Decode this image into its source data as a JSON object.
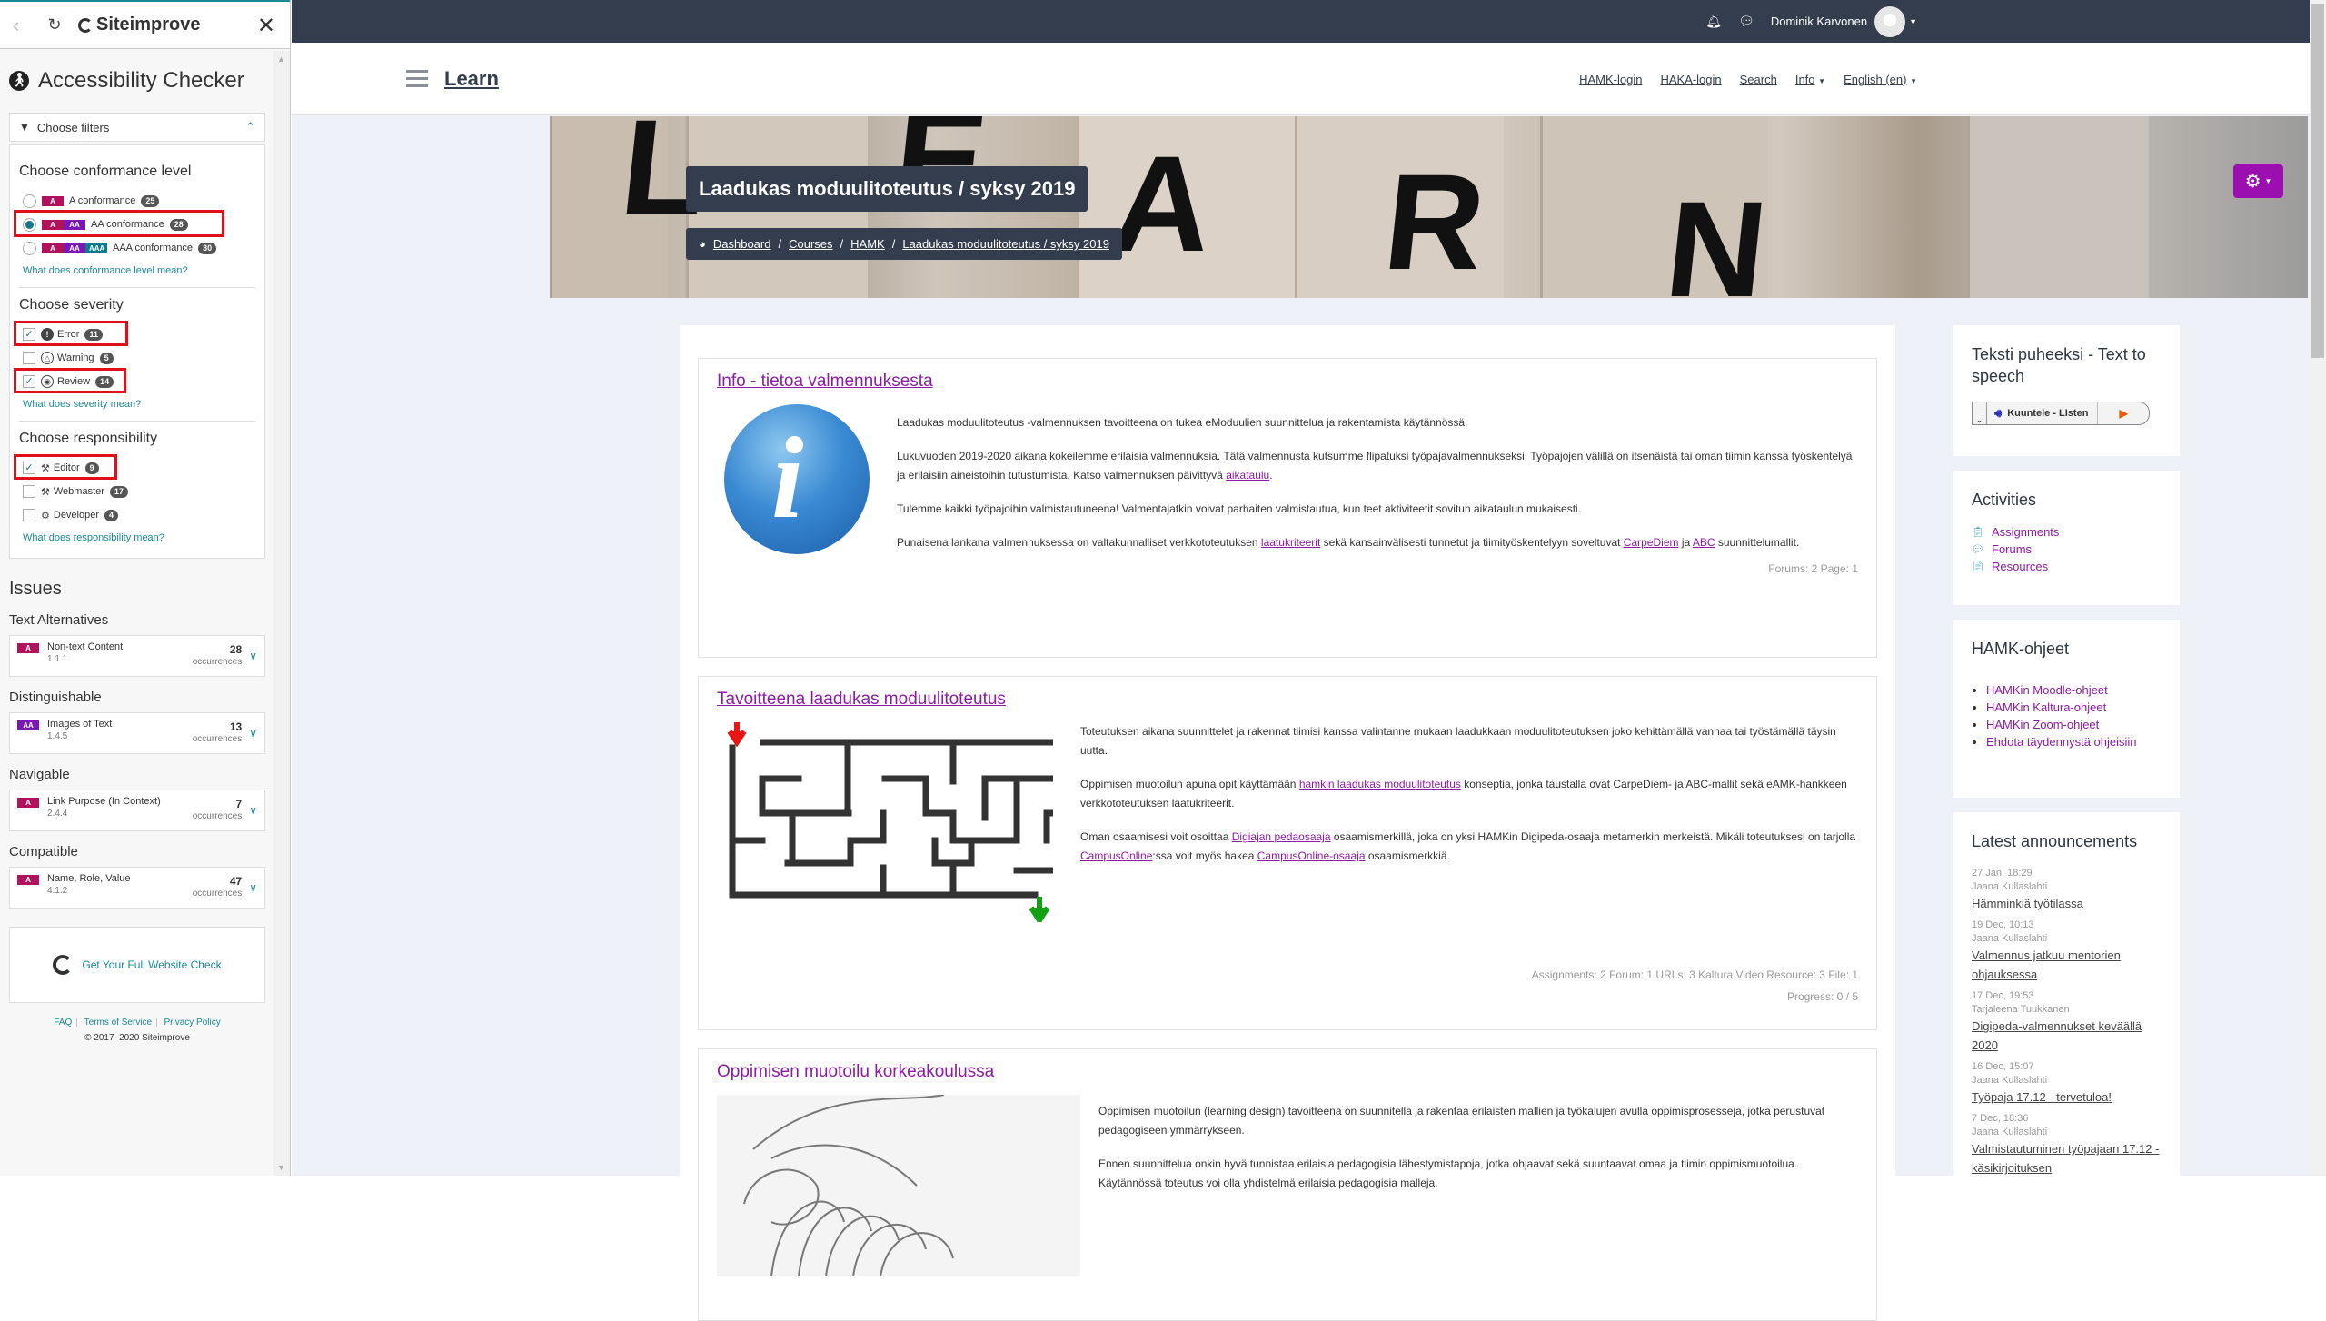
{
  "siteimprove": {
    "brand": "Siteimprove",
    "title": "Accessibility Checker",
    "filters_label": "Choose filters",
    "conformance": {
      "heading": "Choose conformance level",
      "options": [
        {
          "label": "A conformance",
          "count": "25",
          "levels": [
            "A"
          ],
          "selected": false
        },
        {
          "label": "AA conformance",
          "count": "28",
          "levels": [
            "A",
            "AA"
          ],
          "selected": true
        },
        {
          "label": "AAA conformance",
          "count": "30",
          "levels": [
            "A",
            "AA",
            "AAA"
          ],
          "selected": false
        }
      ],
      "help": "What does conformance level mean?"
    },
    "severity": {
      "heading": "Choose severity",
      "options": [
        {
          "label": "Error",
          "count": "11",
          "checked": true,
          "icon": "error-icon"
        },
        {
          "label": "Warning",
          "count": "5",
          "checked": false,
          "icon": "warning-icon"
        },
        {
          "label": "Review",
          "count": "14",
          "checked": true,
          "icon": "review-eye-icon"
        }
      ],
      "help": "What does severity mean?"
    },
    "responsibility": {
      "heading": "Choose responsibility",
      "options": [
        {
          "label": "Editor",
          "count": "9",
          "checked": true,
          "icon": "editor-icon"
        },
        {
          "label": "Webmaster",
          "count": "17",
          "checked": false,
          "icon": "webmaster-icon"
        },
        {
          "label": "Developer",
          "count": "4",
          "checked": false,
          "icon": "developer-icon"
        }
      ],
      "help": "What does responsibility mean?"
    },
    "issues_heading": "Issues",
    "issue_groups": [
      {
        "group": "Text Alternatives",
        "level": "A",
        "name": "Non-text Content",
        "code": "1.1.1",
        "count": "28",
        "unit": "occurrences"
      },
      {
        "group": "Distinguishable",
        "level": "AA",
        "name": "Images of Text",
        "code": "1.4.5",
        "count": "13",
        "unit": "occurrences"
      },
      {
        "group": "Navigable",
        "level": "A",
        "name": "Link Purpose (In Context)",
        "code": "2.4.4",
        "count": "7",
        "unit": "occurrences"
      },
      {
        "group": "Compatible",
        "level": "A",
        "name": "Name, Role, Value",
        "code": "4.1.2",
        "count": "47",
        "unit": "occurrences"
      }
    ],
    "full_check": "Get Your Full Website Check",
    "footer": {
      "faq": "FAQ",
      "terms": "Terms of Service",
      "privacy": "Privacy Policy",
      "copyright": "© 2017–2020 Siteimprove"
    }
  },
  "navbar": {
    "user": "Dominik Karvonen"
  },
  "subnav": {
    "brand": "Learn",
    "links": [
      "HAMK-login",
      "HAKA-login",
      "Search",
      "Info",
      "English (en)"
    ]
  },
  "hero": {
    "title": "Laadukas moduulitoteutus / syksy 2019",
    "breadcrumb": [
      "Dashboard",
      "Courses",
      "HAMK",
      "Laadukas moduulitoteutus / syksy 2019"
    ],
    "letters": [
      "L",
      "E",
      "A",
      "R",
      "N"
    ]
  },
  "sections": [
    {
      "title": "Info - tietoa valmennuksesta",
      "paragraphs": [
        [
          "Laadukas moduulitoteutus -valmennuksen tavoitteena on tukea eModuulien suunnittelua ja rakentamista käytännössä."
        ],
        [
          "Lukuvuoden 2019-2020 aikana kokeilemme erilaisia valmennuksia. Tätä valmennusta kutsumme flipatuksi työpajavalmennukseksi. Työpajojen välillä on itsenäistä tai oman tiimin kanssa työskentelyä ja erilaisiin aineistoihin tutustumista. Katso valmennuksen päivittyvä ",
          {
            "link": "aikataulu"
          },
          "."
        ],
        [
          "Tulemme kaikki työpajoihin valmistautuneena! Valmentajatkin voivat parhaiten valmistautua, kun teet aktiviteetit sovitun aikataulun mukaisesti."
        ],
        [
          "Punaisena lankana valmennuksessa on valtakunnalliset verkkototeutuksen ",
          {
            "link": "laatukriteerit"
          },
          " sekä kansainvälisesti tunnetut ja tiimityöskentelyyn soveltuvat ",
          {
            "link": "CarpeDiem"
          },
          " ja ",
          {
            "link": "ABC"
          },
          " suunnittelumallit."
        ]
      ],
      "meta": [
        "Forums: 2 Page: 1"
      ]
    },
    {
      "title": "Tavoitteena laadukas moduulitoteutus",
      "paragraphs": [
        [
          "Toteutuksen aikana suunnittelet ja rakennat tiimisi kanssa valintanne mukaan laadukkaan moduulitoteutuksen joko kehittämällä vanhaa tai työstämällä täysin uutta."
        ],
        [
          "Oppimisen muotoilun apuna opit käyttämään ",
          {
            "link": "hamkin laadukas moduulitoteutus"
          },
          " konseptia, jonka taustalla ovat CarpeDiem- ja ABC-mallit sekä eAMK-hankkeen verkkototeutuksen laatukriteerit."
        ],
        [
          "Oman osaamisesi voit osoittaa ",
          {
            "link": "Digiajan pedaosaaja"
          },
          " osaamismerkillä, joka on yksi HAMKin Digipeda-osaaja metamerkin merkeistä. Mikäli toteutuksesi on tarjolla ",
          {
            "link": "CampusOnline"
          },
          ":ssa voit myös hakea ",
          {
            "link": "CampusOnline-osaaja"
          },
          " osaamismerkkiä."
        ]
      ],
      "meta": [
        "Assignments: 2  Forum: 1  URLs: 3  Kaltura Video Resource: 3  File: 1",
        "Progress: 0 / 5"
      ]
    },
    {
      "title": "Oppimisen muotoilu korkeakoulussa",
      "paragraphs": [
        [
          "Oppimisen muotoilun (learning design) tavoitteena on suunnitella ja rakentaa erilaisten mallien ja työkalujen avulla oppimisprosesseja, jotka perustuvat pedagogiseen ymmärrykseen."
        ],
        [
          "Ennen suunnittelua onkin hyvä tunnistaa erilaisia pedagogisia lähestymistapoja, jotka ohjaavat sekä suuntaavat omaa ja tiimin oppimismuotoilua. Käytännössä toteutus voi olla yhdistelmä erilaisia pedagogisia malleja."
        ]
      ],
      "meta": []
    }
  ],
  "blocks": {
    "tts": {
      "title": "Teksti puheeksi - Text to speech",
      "button": "Kuuntele - LIsten"
    },
    "activities": {
      "title": "Activities",
      "items": [
        {
          "label": "Assignments",
          "icon": "assignment-icon"
        },
        {
          "label": "Forums",
          "icon": "forum-icon"
        },
        {
          "label": "Resources",
          "icon": "resource-icon"
        }
      ]
    },
    "hamk": {
      "title": "HAMK-ohjeet",
      "items": [
        "HAMKin Moodle-ohjeet",
        "HAMKin Kaltura-ohjeet",
        "HAMKin Zoom-ohjeet",
        "Ehdota täydennystä ohjeisiin"
      ]
    },
    "announcements": {
      "title": "Latest announcements",
      "items": [
        {
          "date": "27 Jan, 18:29",
          "author": "Jaana Kullaslahti",
          "title": "Hämminkiä työtilassa"
        },
        {
          "date": "19 Dec, 10:13",
          "author": "Jaana Kullaslahti",
          "title": "Valmennus jatkuu mentorien ohjauksessa"
        },
        {
          "date": "17 Dec, 19:53",
          "author": "Tarjaleena Tuukkanen",
          "title": "Digipeda-valmennukset keväällä 2020"
        },
        {
          "date": "16 Dec, 15:07",
          "author": "Jaana Kullaslahti",
          "title": "Työpaja 17.12 - tervetuloa!"
        },
        {
          "date": "7 Dec, 18:36",
          "author": "Jaana Kullaslahti",
          "title": "Valmistautuminen työpajaan 17.12 - käsikirjoituksen"
        }
      ]
    }
  }
}
